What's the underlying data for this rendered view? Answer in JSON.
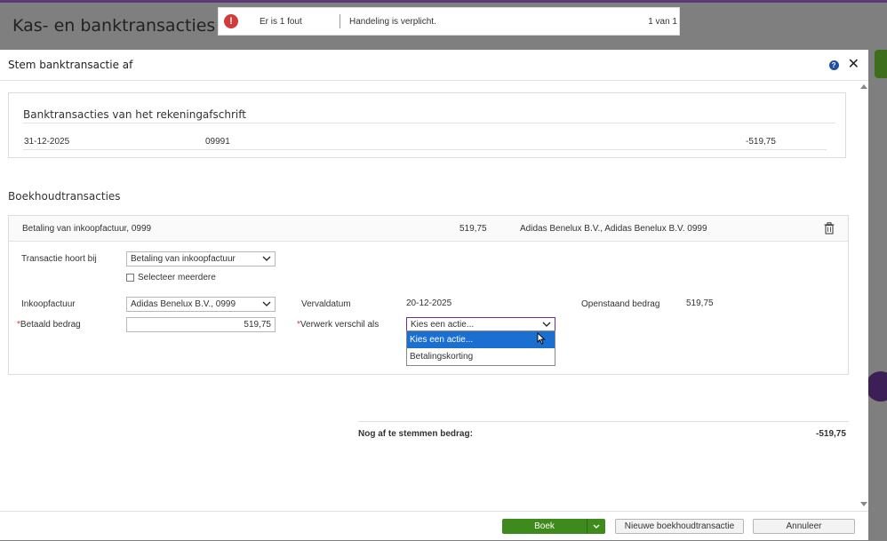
{
  "background": {
    "page_title": "Kas- en banktransacties"
  },
  "error_bar": {
    "icon_glyph": "!",
    "count_text": "Er is 1 fout",
    "message": "Handeling is verplicht.",
    "pager": "1 van 1"
  },
  "modal": {
    "title": "Stem banktransactie af",
    "help_glyph": "?",
    "close_glyph": "✕"
  },
  "bank": {
    "section_title": "Banktransacties van het rekeningafschrift",
    "date": "31-12-2025",
    "reference": "09991",
    "amount": "-519,75"
  },
  "accounting": {
    "section_title": "Boekhoudtransacties",
    "row": {
      "description": "Betaling van inkoopfactuur, 0999",
      "amount": "519,75",
      "party": "Adidas Benelux B.V., Adidas Benelux B.V. 0999"
    },
    "form": {
      "belongs_to_label": "Transactie hoort bij",
      "belongs_to_value": "Betaling van inkoopfactuur",
      "select_multiple_label": "Selecteer meerdere",
      "invoice_label": "Inkoopfactuur",
      "invoice_value": "Adidas Benelux B.V., 0999",
      "due_date_label": "Vervaldatum",
      "due_date_value": "20-12-2025",
      "outstanding_label": "Openstaand bedrag",
      "outstanding_value": "519,75",
      "paid_required_mark": "*",
      "paid_label": "Betaald bedrag",
      "paid_value": "519,75",
      "difference_required_mark": "*",
      "difference_label": "Verwerk verschil als",
      "difference_value": "Kies een actie...",
      "difference_options": [
        "Kies een actie...",
        "Betalingskorting"
      ]
    }
  },
  "summary": {
    "label": "Nog af te stemmen bedrag:",
    "value": "-519,75"
  },
  "footer": {
    "book_label": "Boek",
    "new_transaction_label": "Nieuwe boekhoudtransactie",
    "cancel_label": "Annuleer"
  },
  "colors": {
    "accent_green": "#3f8a1c",
    "error_red": "#d23b3b",
    "selection_blue": "#1a6fd1",
    "focus_purple": "#6b2f8f",
    "help_blue": "#1f4fa3"
  }
}
